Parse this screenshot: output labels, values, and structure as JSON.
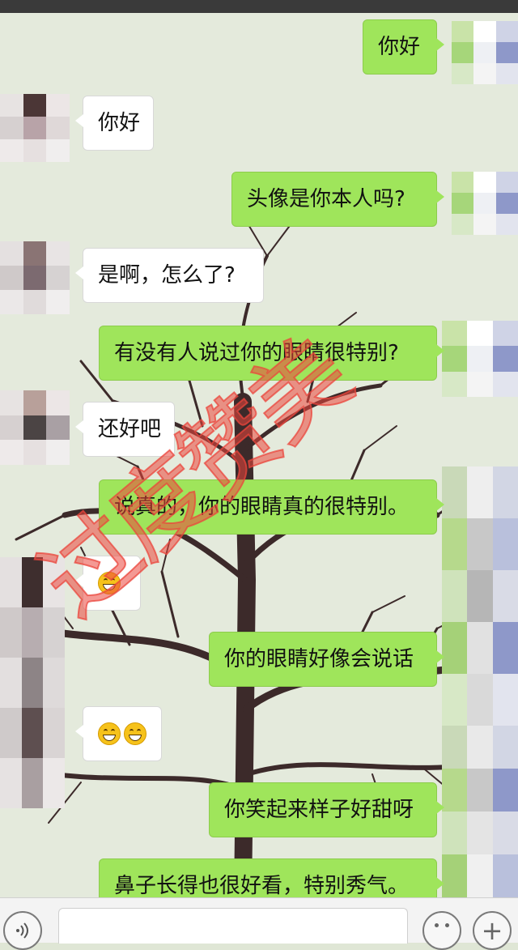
{
  "messages": [
    {
      "side": "me",
      "text": "你好"
    },
    {
      "side": "them",
      "text": "你好"
    },
    {
      "side": "me",
      "text": "头像是你本人吗?"
    },
    {
      "side": "them",
      "text": "是啊，怎么了?"
    },
    {
      "side": "me",
      "text": "有没有人说过你的眼睛很特别?"
    },
    {
      "side": "them",
      "text": "还好吧"
    },
    {
      "side": "me",
      "text": "说真的，你的眼睛真的很特别。"
    },
    {
      "side": "them",
      "emoji_count": 1,
      "emoji_name": "grin-emoji"
    },
    {
      "side": "me",
      "text": "你的眼睛好像会说话"
    },
    {
      "side": "them",
      "emoji_count": 2,
      "emoji_name": "grin-emoji"
    },
    {
      "side": "me",
      "text": "你笑起来样子好甜呀"
    },
    {
      "side": "me",
      "text": "鼻子长得也很好看，特别秀气。"
    }
  ],
  "watermark": "过度赞美",
  "input_bar": {
    "voice_icon": "voice-icon",
    "emoji_icon": "emoji-icon",
    "plus_icon": "plus-icon"
  },
  "colors": {
    "my_bubble": "#9fe55b",
    "their_bubble": "#ffffff",
    "watermark": "#eb463c",
    "background": "#dfe6d5"
  }
}
